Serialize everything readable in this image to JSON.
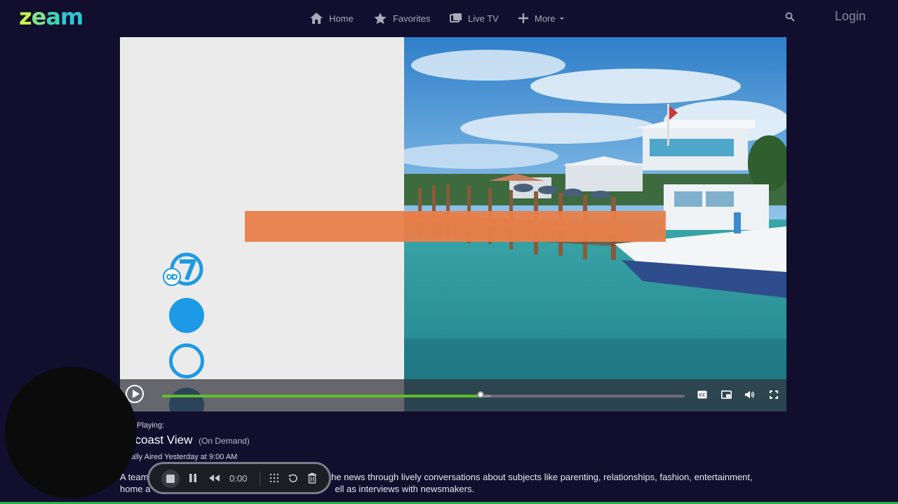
{
  "logo": {
    "z": "z",
    "e": "e",
    "a": "a",
    "m": "m"
  },
  "nav": {
    "home": "Home",
    "favorites": "Favorites",
    "live_tv": "Live TV",
    "more": "More",
    "login": "Login"
  },
  "player": {
    "progress_fraction": 0.61,
    "buffer_fraction": 0.63
  },
  "info": {
    "now_playing": "Playing:",
    "title": "ncoast View",
    "title_tag": "(On Demand)",
    "aired": "ginally Aired Yesterday at 9:00 AM",
    "description_left_1": "A team",
    "description_right_1": "the news through lively conversations about subjects like parenting, relationships, fashion, entertainment,",
    "description_left_2": "home a",
    "description_right_2": "ell as interviews with newsmakers."
  },
  "recorder": {
    "time": "0:00"
  },
  "icons": {
    "home": "home-icon",
    "favorites": "star-icon",
    "live_tv": "live-tv-icon",
    "more": "plus-icon",
    "search": "search-icon",
    "cc": "closed-captions-icon",
    "pip": "picture-in-picture-icon",
    "volume": "volume-icon",
    "fullscreen": "fullscreen-icon"
  },
  "colors": {
    "background": "#120e2e",
    "progress": "#5fbe2c",
    "brand_blue": "#1d9ae6",
    "accent_orange": "#e8804a"
  }
}
